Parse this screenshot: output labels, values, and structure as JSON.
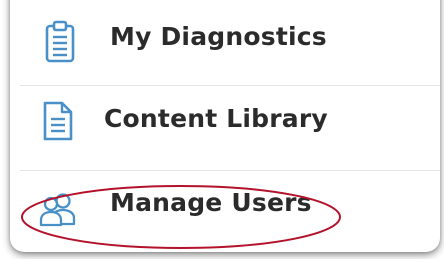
{
  "menu": {
    "items": [
      {
        "label": "My Diagnostics",
        "icon": "clipboard-icon"
      },
      {
        "label": "Content Library",
        "icon": "document-icon"
      },
      {
        "label": "Manage Users",
        "icon": "users-icon"
      }
    ],
    "highlighted_item": "Manage Users"
  },
  "colors": {
    "icon_blue": "#4a90c8",
    "label_text": "#2b2b2b",
    "annotation_red": "#b3122a",
    "divider": "#e2e5e8"
  }
}
